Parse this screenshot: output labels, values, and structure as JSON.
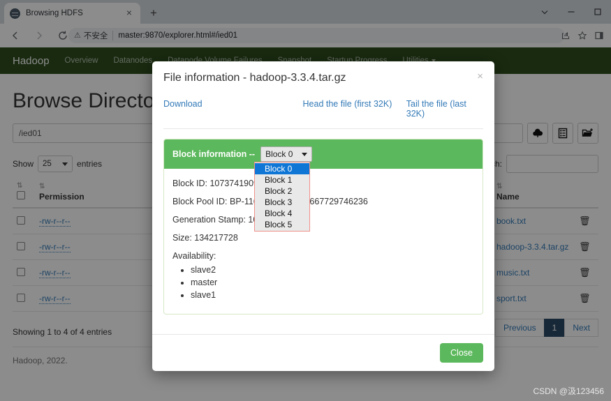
{
  "browser": {
    "tab": {
      "title": "Browsing HDFS",
      "favicon": "globe-icon",
      "close": "×"
    },
    "newtab": "+",
    "window": {
      "chevron": "chevron-down-icon",
      "minimize": "minimize-icon",
      "maximize": "maximize-icon"
    },
    "omnibox": {
      "warning_icon": "⚠",
      "security_label": "不安全",
      "url": "master:9870/explorer.html#/ied01"
    },
    "actions": {
      "back": "back-arrow-icon",
      "forward": "forward-arrow-icon",
      "reload": "reload-icon",
      "share": "share-icon",
      "bookmark": "star-icon",
      "sidepanel": "side-panel-icon"
    }
  },
  "hadoop_nav": {
    "brand": "Hadoop",
    "links": [
      "Overview",
      "Datanodes",
      "Datanode Volume Failures",
      "Snapshot",
      "Startup Progress"
    ],
    "dropdown": "Utilities"
  },
  "page": {
    "title": "Browse Directory",
    "path_value": "/ied01",
    "toolbar": [
      {
        "name": "upload-button",
        "icon": "cloud-upload-icon"
      },
      {
        "name": "cut-paste-button",
        "icon": "clipboard-list-icon"
      },
      {
        "name": "new-folder-button",
        "icon": "folder-plus-icon"
      }
    ],
    "show_label": "Show",
    "entries_count": "25",
    "entries_label": "entries",
    "search_label": "Search:",
    "search_value": "",
    "columns": [
      "Permission",
      "Name"
    ],
    "rows": [
      {
        "permission": "-rw-r--r--",
        "name": "book.txt"
      },
      {
        "permission": "-rw-r--r--",
        "name": "hadoop-3.3.4.tar.gz"
      },
      {
        "permission": "-rw-r--r--",
        "name": "music.txt"
      },
      {
        "permission": "-rw-r--r--",
        "name": "sport.txt"
      }
    ],
    "showing": "Showing 1 to 4 of 4 entries",
    "pagination": {
      "previous": "Previous",
      "page": "1",
      "next": "Next"
    },
    "footer": "Hadoop, 2022."
  },
  "modal": {
    "title": "File information - hadoop-3.3.4.tar.gz",
    "close_icon": "×",
    "links": {
      "download": "Download",
      "head": "Head the file (first 32K)",
      "tail": "Tail the file (last 32K)"
    },
    "panel": {
      "heading": "Block information --",
      "selected_block": "Block 0",
      "options": [
        "Block 0",
        "Block 1",
        "Block 2",
        "Block 3",
        "Block 4",
        "Block 5"
      ],
      "block_id": "Block ID: 1073741909",
      "block_pool_id": "Block Pool ID: BP-1160168.1.101-1667729746236",
      "block_pool_id_visible_tail": "168.1.101-1667729746236",
      "generation_stamp": "Generation Stamp: 10",
      "size": "Size: 134217728",
      "availability_label": "Availability:",
      "availability": [
        "slave2",
        "master",
        "slave1"
      ]
    },
    "close_button": "Close"
  },
  "watermark": "CSDN @汲123456",
  "colors": {
    "hadoop_green": "#2e4d1e",
    "panel_green": "#5cb85c",
    "link_blue": "#337ab7",
    "option_highlight": "#1076d6",
    "dropdown_border": "#f0918a",
    "page_active": "#2b4a66"
  }
}
